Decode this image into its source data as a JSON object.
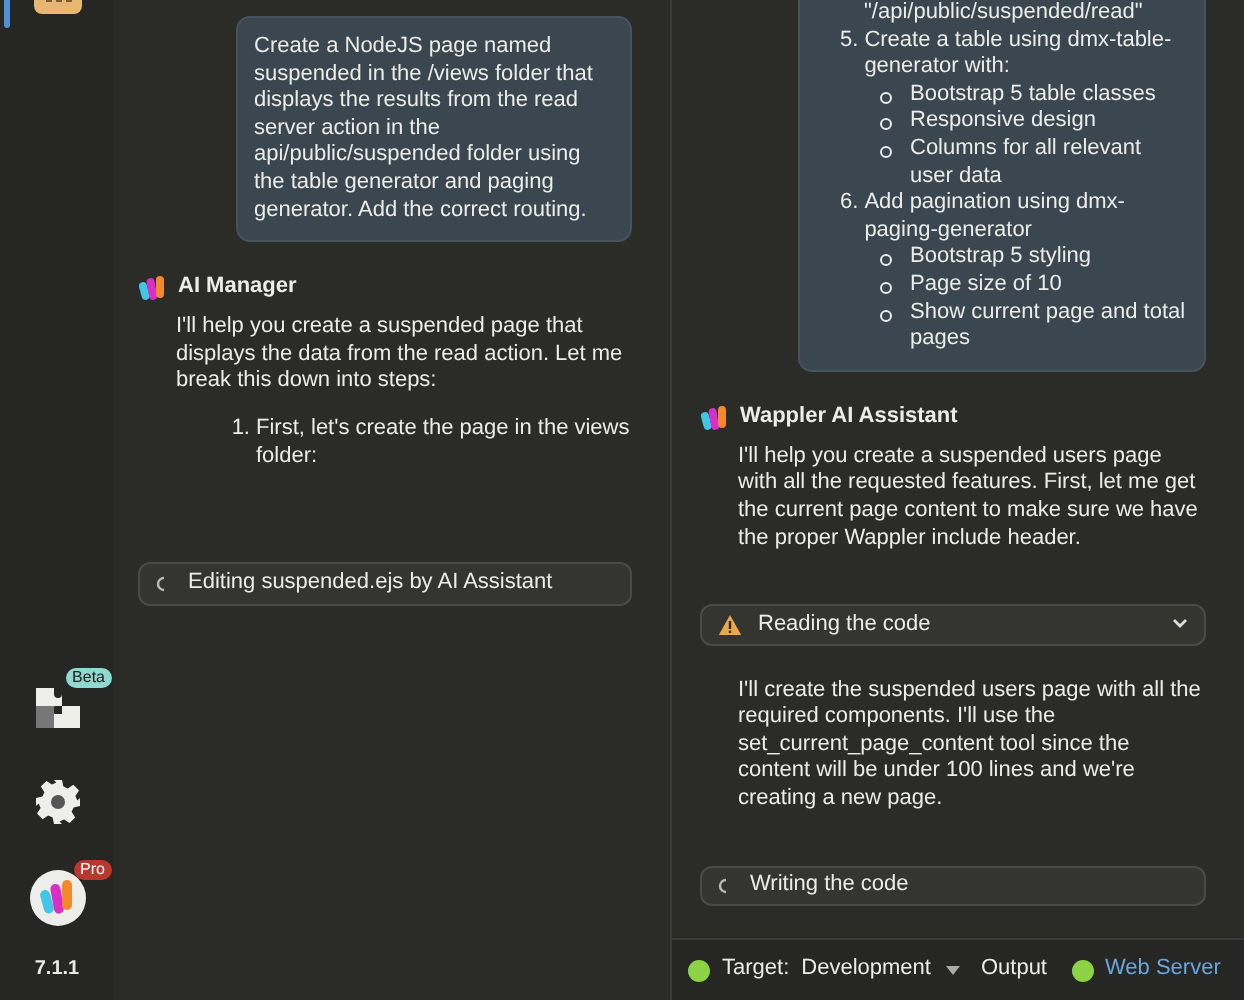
{
  "sidebar": {
    "items": [
      {
        "kind": "assistant",
        "selected": true
      },
      {
        "kind": "extensions",
        "badge": "Beta",
        "selected": false
      },
      {
        "kind": "settings",
        "selected": false
      },
      {
        "kind": "account",
        "badge": "Pro",
        "selected": false
      }
    ],
    "version": "7.1.1"
  },
  "left_chat": {
    "messages": [
      {
        "kind": "user",
        "text": "Create a NodeJS page named suspended in the /views folder that displays the results from the read server action in the api/public/suspended folder using the table generator and paging generator. Add the correct routing."
      },
      {
        "kind": "assistant",
        "name": "AI Manager",
        "text": "I'll help you create a suspended page that displays the data from the read action. Let me break this down into steps:",
        "steps": [
          {
            "number": "1.",
            "text": "First, let's create the page in the views folder:"
          }
        ]
      },
      {
        "kind": "tool_loading",
        "label": "Editing suspended.ejs by AI Assistant",
        "expandable": false
      }
    ]
  },
  "right_chat": {
    "messages": [
      {
        "kind": "user",
        "continuation": "\"/api/public/suspended/read\"",
        "steps": [
          {
            "number": "5.",
            "text": "Create a table using dmx-table-generator with:",
            "bullets": [
              "Bootstrap 5 table classes",
              "Responsive design",
              "Columns for all relevant user data"
            ]
          },
          {
            "number": "6.",
            "text": "Add pagination using dmx-paging-generator",
            "bullets": [
              "Bootstrap 5 styling",
              "Page size of 10",
              "Show current page and total pages"
            ]
          }
        ]
      },
      {
        "kind": "assistant",
        "name": "Wappler AI Assistant",
        "text": "I'll help you create a suspended users page with all the requested features. First, let me get the current page content to make sure we have the proper Wappler include header."
      },
      {
        "kind": "tool_warning",
        "label": "Reading the code",
        "expandable": true
      },
      {
        "kind": "assistant",
        "text": "I'll create the suspended users page with all the required components. I'll use the set_current_page_content tool since the content will be under 100 lines and we're creating a new page."
      },
      {
        "kind": "tool_loading",
        "label": "Writing the code",
        "expandable": false
      }
    ]
  },
  "status_bar": {
    "target_label": "Target:",
    "target_value": "Development",
    "output": "Output",
    "server_label": "Web Server"
  }
}
